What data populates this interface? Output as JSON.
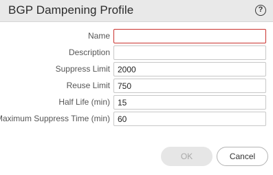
{
  "dialog": {
    "title": "BGP Dampening Profile",
    "help_icon": "help-icon"
  },
  "form": {
    "name": {
      "label": "Name",
      "value": ""
    },
    "description": {
      "label": "Description",
      "value": ""
    },
    "suppress_limit": {
      "label": "Suppress Limit",
      "value": "2000"
    },
    "reuse_limit": {
      "label": "Reuse Limit",
      "value": "750"
    },
    "half_life": {
      "label": "Half Life (min)",
      "value": "15"
    },
    "max_suppress_time": {
      "label": "Maximum Suppress Time (min)",
      "value": "60"
    }
  },
  "buttons": {
    "ok_label": "OK",
    "cancel_label": "Cancel"
  },
  "colors": {
    "required_border": "#c9302c",
    "header_bg": "#e9e9e9"
  }
}
